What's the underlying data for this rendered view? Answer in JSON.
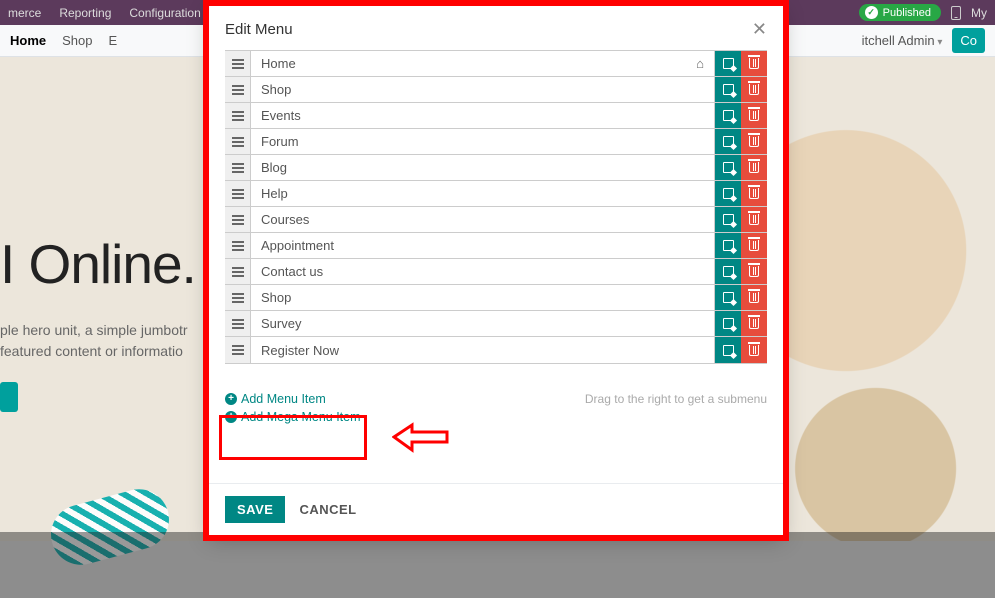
{
  "topbar": {
    "left": [
      "merce",
      "Reporting",
      "Configuration"
    ],
    "published_label": "Published",
    "right_text": "My"
  },
  "navbar": {
    "items": [
      "Home",
      "Shop",
      "E"
    ],
    "user": "itchell Admin",
    "cta": "Co"
  },
  "hero": {
    "title": "I Online.",
    "line1": "ple hero unit, a simple jumbotr",
    "line2": "featured content or informatio"
  },
  "modal": {
    "title": "Edit Menu",
    "menu_items": [
      {
        "label": "Home",
        "is_home": true
      },
      {
        "label": "Shop"
      },
      {
        "label": "Events"
      },
      {
        "label": "Forum"
      },
      {
        "label": "Blog"
      },
      {
        "label": "Help"
      },
      {
        "label": "Courses"
      },
      {
        "label": "Appointment"
      },
      {
        "label": "Contact us"
      },
      {
        "label": "Shop"
      },
      {
        "label": "Survey"
      },
      {
        "label": "Register Now"
      }
    ],
    "add_item": "Add Menu Item",
    "add_mega": "Add Mega Menu Item",
    "hint": "Drag to the right to get a submenu",
    "save": "SAVE",
    "cancel": "CANCEL"
  }
}
